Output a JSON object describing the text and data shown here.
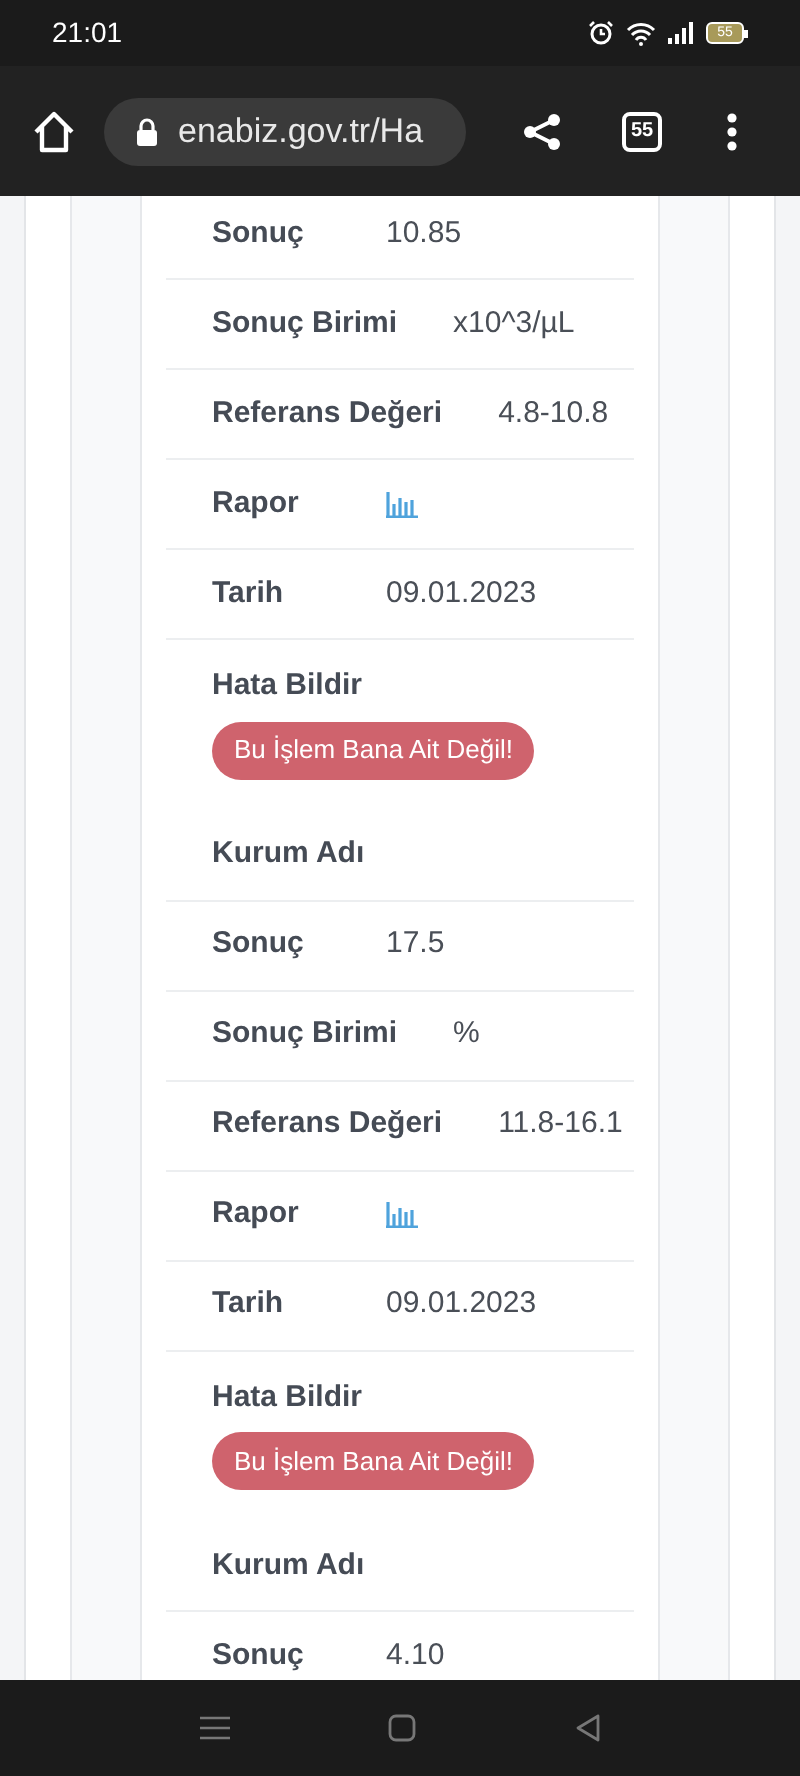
{
  "status_bar": {
    "time": "21:01",
    "battery": "55"
  },
  "browser": {
    "url": "enabiz.gov.tr/Ha",
    "tab_count": "55"
  },
  "rows": [
    {
      "kind": "field",
      "label": "Sonuç",
      "value": "10.85"
    },
    {
      "kind": "field",
      "label": "Sonuç Birimi",
      "value": "x10^3/µL"
    },
    {
      "kind": "field",
      "label": "Referans Değeri",
      "value": "4.8-10.8"
    },
    {
      "kind": "chart",
      "label": "Rapor"
    },
    {
      "kind": "field",
      "label": "Tarih",
      "value": "09.01.2023"
    },
    {
      "kind": "action",
      "label": "Hata Bildir",
      "button": "Bu İşlem Bana Ait Değil!"
    },
    {
      "kind": "field",
      "label": "Kurum Adı"
    },
    {
      "kind": "field",
      "label": "Sonuç",
      "value": "17.5"
    },
    {
      "kind": "field",
      "label": "Sonuç Birimi",
      "value": "%"
    },
    {
      "kind": "field",
      "label": "Referans Değeri",
      "value": "11.8-16.1"
    },
    {
      "kind": "chart",
      "label": "Rapor"
    },
    {
      "kind": "field",
      "label": "Tarih",
      "value": "09.01.2023"
    },
    {
      "kind": "action",
      "label": "Hata Bildir",
      "button": "Bu İşlem Bana Ait Değil!"
    },
    {
      "kind": "field",
      "label": "Kurum Adı"
    },
    {
      "kind": "field",
      "label": "Sonuç",
      "value": "4.10"
    }
  ]
}
